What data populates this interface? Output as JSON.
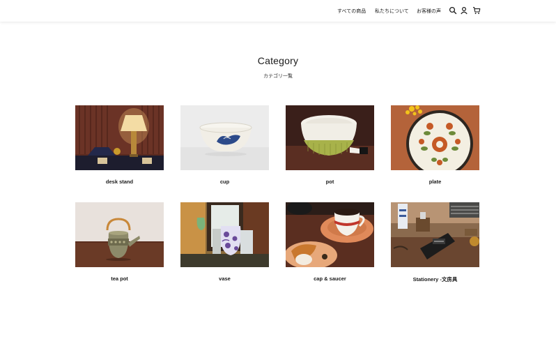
{
  "nav": {
    "items": [
      {
        "label": "すべての商品"
      },
      {
        "label": "私たちについて"
      },
      {
        "label": "お客様の声"
      }
    ],
    "icons": [
      "search-icon",
      "user-icon",
      "cart-icon"
    ]
  },
  "page": {
    "title": "Category",
    "subtitle": "カテゴリ一覧"
  },
  "categories": [
    {
      "label": "desk stand"
    },
    {
      "label": "cup"
    },
    {
      "label": "pot"
    },
    {
      "label": "plate"
    },
    {
      "label": "tea pot"
    },
    {
      "label": "vase"
    },
    {
      "label": "cap & saucer"
    },
    {
      "label": "Stationery -文房具"
    }
  ]
}
